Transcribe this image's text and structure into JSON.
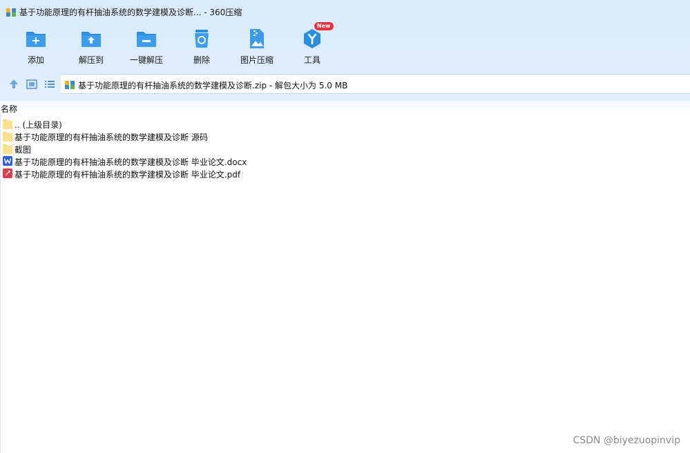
{
  "window": {
    "title": "基于功能原理的有杆抽油系统的数学建模及诊断... - 360压缩"
  },
  "toolbar": {
    "items": [
      {
        "label": "添加",
        "icon": "add-folder-icon"
      },
      {
        "label": "解压到",
        "icon": "extract-to-icon"
      },
      {
        "label": "一键解压",
        "icon": "one-click-extract-icon"
      },
      {
        "label": "删除",
        "icon": "recycle-bin-icon"
      },
      {
        "label": "图片压缩",
        "icon": "image-compress-icon"
      },
      {
        "label": "工具",
        "icon": "tools-icon",
        "badge": "New"
      }
    ]
  },
  "address": {
    "path": "基于功能原理的有杆抽油系统的数学建模及诊断.zip - 解包大小为 5.0 MB"
  },
  "list": {
    "column_name": "名称",
    "rows": [
      {
        "name": ".. (上级目录)",
        "type": "folder"
      },
      {
        "name": "基于功能原理的有杆抽油系统的数学建模及诊断 源码",
        "type": "folder"
      },
      {
        "name": "截图",
        "type": "folder"
      },
      {
        "name": "基于功能原理的有杆抽油系统的数学建模及诊断 毕业论文.docx",
        "type": "word"
      },
      {
        "name": "基于功能原理的有杆抽油系统的数学建模及诊断 毕业论文.pdf",
        "type": "pdf"
      }
    ]
  },
  "watermark": "CSDN @biyezuopinvip",
  "colors": {
    "accent": "#2b8fe0",
    "toolbar_bg": "#dcecfb",
    "folder": "#f7d774",
    "word": "#2b5fd9",
    "pdf": "#e03a4e",
    "badge": "#e8313b"
  }
}
